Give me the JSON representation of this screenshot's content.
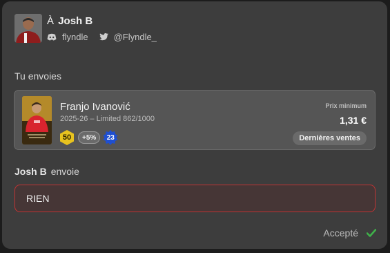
{
  "header": {
    "to_prefix": "À",
    "recipient_name": "Josh B",
    "discord_icon": "discord-icon",
    "discord_handle": "flyndle",
    "twitter_icon": "twitter-icon",
    "twitter_handle": "@Flyndle_"
  },
  "send_section": {
    "label": "Tu envoies",
    "card": {
      "player_name": "Franjo Ivanović",
      "card_info": "2025-26 – Limited 862/1000",
      "rating": "50",
      "bonus": "+5%",
      "level": "23",
      "price_label": "Prix minimum",
      "price_value": "1,31 €",
      "sales_button": "Dernières ventes",
      "colors": {
        "rating": "#e8c31f",
        "level": "#1f4fd0"
      }
    }
  },
  "receive_section": {
    "sender_name": "Josh B",
    "sender_suffix": "envoie",
    "content": "RIEN"
  },
  "status": {
    "label": "Accepté",
    "icon": "checkmark-icon",
    "color": "#3fb24a"
  },
  "colors": {
    "panel": "#3d3d3d",
    "card": "#555555",
    "alert_border": "#c23434"
  }
}
